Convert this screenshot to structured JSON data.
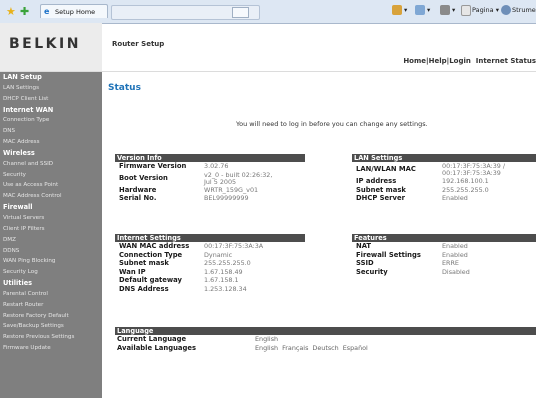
{
  "browser": {
    "tab_title": "Setup Home",
    "tools": {
      "home": "",
      "page": "Pagina",
      "tools": "Strumenti"
    }
  },
  "header": {
    "logo": "BELKIN",
    "subtitle": "Router Setup",
    "nav": {
      "home": "Home",
      "help": "Help",
      "login": "Login",
      "internet_status": "Internet Status"
    }
  },
  "sidebar": {
    "items": [
      {
        "label": "LAN Setup",
        "head": true
      },
      {
        "label": "LAN Settings",
        "head": false
      },
      {
        "label": "DHCP Client List",
        "head": false
      },
      {
        "label": "Internet WAN",
        "head": true
      },
      {
        "label": "Connection Type",
        "head": false
      },
      {
        "label": "DNS",
        "head": false
      },
      {
        "label": "MAC Address",
        "head": false
      },
      {
        "label": "Wireless",
        "head": true
      },
      {
        "label": "Channel and SSID",
        "head": false
      },
      {
        "label": "Security",
        "head": false
      },
      {
        "label": "Use as Access Point",
        "head": false
      },
      {
        "label": "MAC Address Control",
        "head": false
      },
      {
        "label": "Firewall",
        "head": true
      },
      {
        "label": "Virtual Servers",
        "head": false
      },
      {
        "label": "Client IP Filters",
        "head": false
      },
      {
        "label": "DMZ",
        "head": false
      },
      {
        "label": "DDNS",
        "head": false
      },
      {
        "label": "WAN Ping Blocking",
        "head": false
      },
      {
        "label": "Security Log",
        "head": false
      },
      {
        "label": "Utilities",
        "head": true
      },
      {
        "label": "Parental Control",
        "head": false
      },
      {
        "label": "Restart Router",
        "head": false
      },
      {
        "label": "Restore Factory Default",
        "head": false
      },
      {
        "label": "Save/Backup Settings",
        "head": false
      },
      {
        "label": "Restore Previous Settings",
        "head": false
      },
      {
        "label": "Firmware Update",
        "head": false
      }
    ]
  },
  "main": {
    "title": "Status",
    "login_message": "You will need to log in before you can change any settings.",
    "version_info": {
      "title": "Version Info",
      "rows": [
        {
          "label": "Firmware Version",
          "value": "3.02.76"
        },
        {
          "label": "Boot Version",
          "value": "v2_0 - built 02:26:32,\nJul 5 2005"
        },
        {
          "label": "Hardware",
          "value": "WRTR_159G_v01"
        },
        {
          "label": "Serial No.",
          "value": "BEL99999999"
        }
      ]
    },
    "lan_settings": {
      "title": "LAN Settings",
      "rows": [
        {
          "label": "LAN/WLAN MAC",
          "value": "00:17:3F:75:3A:39 /\n00:17:3F:75:3A:39"
        },
        {
          "label": "IP address",
          "value": "192.168.100.1"
        },
        {
          "label": "Subnet mask",
          "value": "255.255.255.0"
        },
        {
          "label": "DHCP Server",
          "value": "Enabled"
        }
      ]
    },
    "internet_settings": {
      "title": "Internet Settings",
      "rows": [
        {
          "label": "WAN MAC address",
          "value": "00:17:3F:75:3A:3A"
        },
        {
          "label": "Connection Type",
          "value": "Dynamic"
        },
        {
          "label": "Subnet mask",
          "value": "255.255.255.0"
        },
        {
          "label": "Wan IP",
          "value": "1.67.158.49"
        },
        {
          "label": "Default gateway",
          "value": "1.67.158.1"
        },
        {
          "label": "DNS Address",
          "value": "1.253.128.34"
        }
      ]
    },
    "features": {
      "title": "Features",
      "rows": [
        {
          "label": "NAT",
          "value": "Enabled"
        },
        {
          "label": "Firewall Settings",
          "value": "Enabled"
        },
        {
          "label": "SSID",
          "value": "ERRE"
        },
        {
          "label": "Security",
          "value": "Disabled"
        }
      ]
    },
    "language": {
      "title": "Language",
      "current_label": "Current Language",
      "current_value": "English",
      "available_label": "Available Languages",
      "available": [
        "English",
        "Français",
        "Deutsch",
        "Español"
      ]
    }
  }
}
